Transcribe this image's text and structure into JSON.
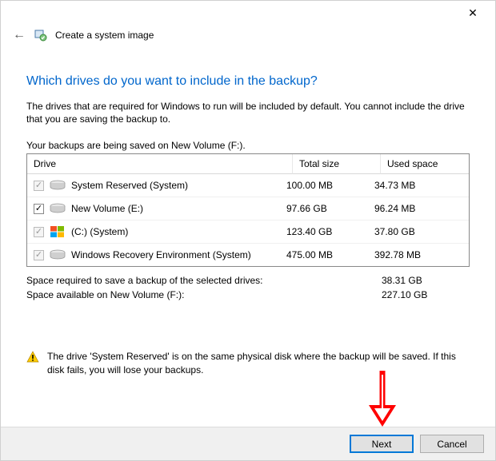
{
  "window": {
    "close_glyph": "✕"
  },
  "header": {
    "back_glyph": "←",
    "title": "Create a system image"
  },
  "main": {
    "heading": "Which drives do you want to include in the backup?",
    "description": "The drives that are required for Windows to run will be included by default. You cannot include the drive that you are saving the backup to.",
    "save_location_text": "Your backups are being saved on New Volume (F:)."
  },
  "table": {
    "headers": {
      "drive": "Drive",
      "total": "Total size",
      "used": "Used space"
    },
    "rows": [
      {
        "checked": true,
        "enabled": false,
        "icon": "hdd",
        "label": "System Reserved (System)",
        "total": "100.00 MB",
        "used": "34.73 MB"
      },
      {
        "checked": true,
        "enabled": true,
        "icon": "hdd",
        "label": "New Volume (E:)",
        "total": "97.66 GB",
        "used": "96.24 MB"
      },
      {
        "checked": true,
        "enabled": false,
        "icon": "win",
        "label": "(C:) (System)",
        "total": "123.40 GB",
        "used": "37.80 GB"
      },
      {
        "checked": true,
        "enabled": false,
        "icon": "hdd",
        "label": "Windows Recovery Environment (System)",
        "total": "475.00 MB",
        "used": "392.78 MB"
      }
    ]
  },
  "summary": {
    "required_label": "Space required to save a backup of the selected drives:",
    "required_value": "38.31 GB",
    "available_label": "Space available on New Volume (F:):",
    "available_value": "227.10 GB"
  },
  "warning": {
    "text": "The drive 'System Reserved' is on the same physical disk where the backup will be saved. If this disk fails, you will lose your backups."
  },
  "footer": {
    "next_label": "Next",
    "cancel_label": "Cancel"
  }
}
